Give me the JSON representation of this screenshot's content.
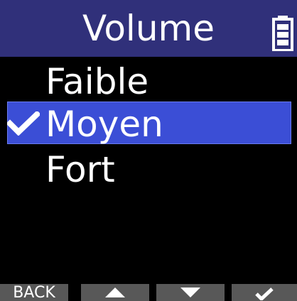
{
  "header": {
    "title": "Volume",
    "battery_icon": "battery-icon"
  },
  "menu": {
    "items": [
      {
        "label": "Faible",
        "selected": false
      },
      {
        "label": "Moyen",
        "selected": true
      },
      {
        "label": "Fort",
        "selected": false
      }
    ],
    "selected_icon": "checkmark-icon",
    "highlight_color": "#3b4ed6"
  },
  "softkeys": {
    "back_label": "BACK",
    "up_icon": "triangle-up-icon",
    "down_icon": "triangle-down-icon",
    "confirm_icon": "checkmark-icon"
  },
  "colors": {
    "header_bg": "#30307a",
    "screen_bg": "#000000",
    "softkey_bg": "#585858",
    "text": "#ffffff"
  }
}
